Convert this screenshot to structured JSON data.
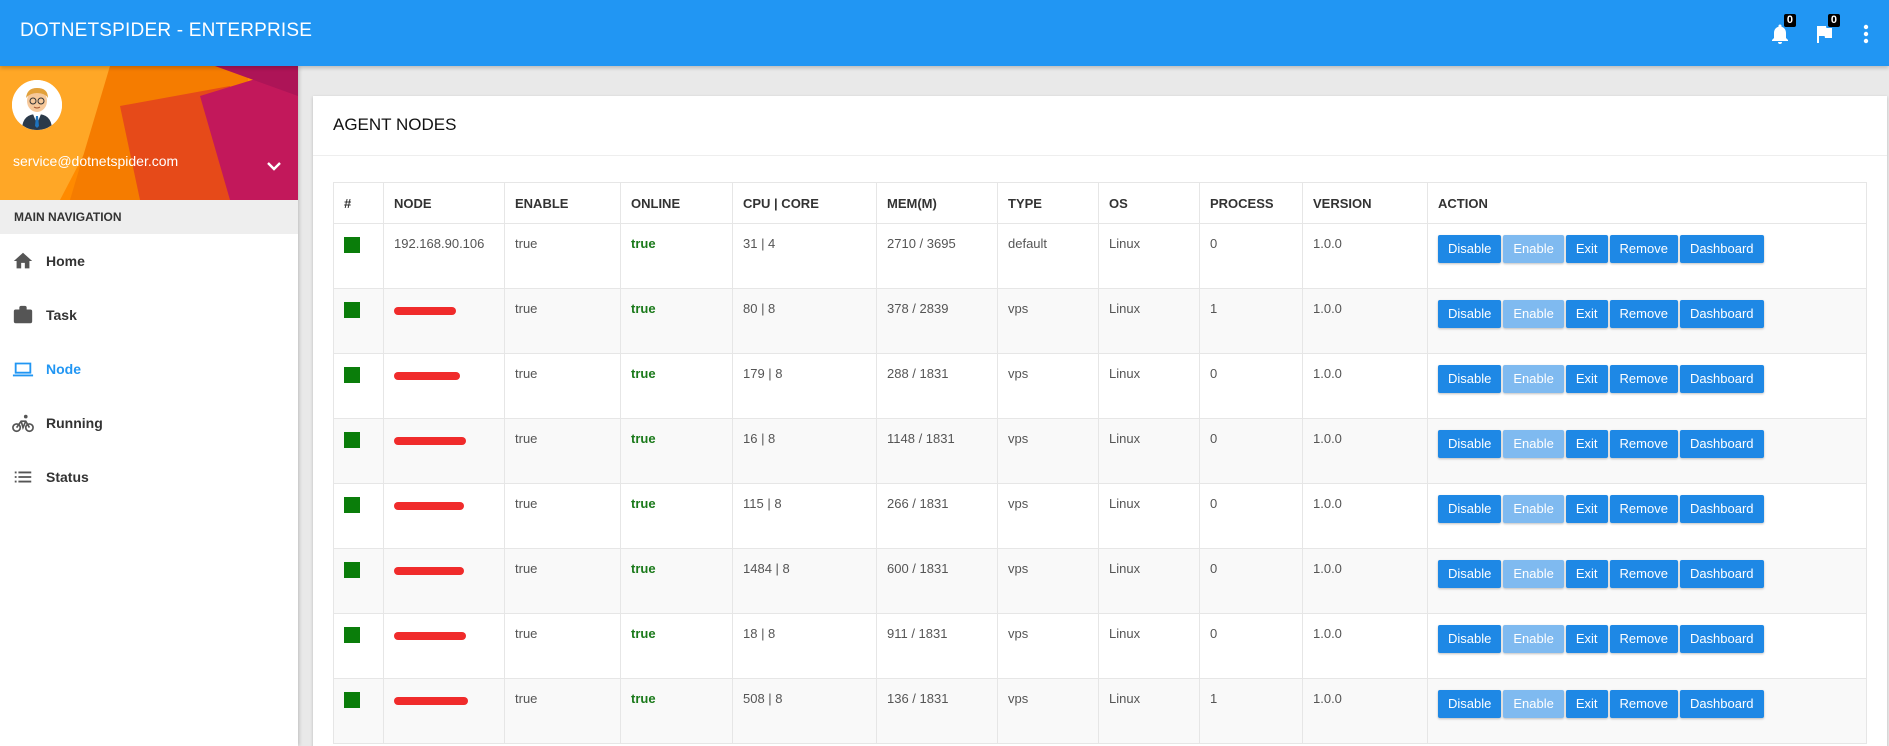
{
  "app": {
    "title": "DOTNETSPIDER - ENTERPRISE"
  },
  "header": {
    "notifications_count": "0",
    "flags_count": "0"
  },
  "user": {
    "email": "service@dotnetspider.com"
  },
  "nav": {
    "header": "MAIN NAVIGATION",
    "items": [
      {
        "label": "Home",
        "icon": "home-icon"
      },
      {
        "label": "Task",
        "icon": "briefcase-icon"
      },
      {
        "label": "Node",
        "icon": "laptop-icon"
      },
      {
        "label": "Running",
        "icon": "bicycle-icon"
      },
      {
        "label": "Status",
        "icon": "list-icon"
      }
    ],
    "active": "Node"
  },
  "page": {
    "title": "AGENT NODES"
  },
  "table": {
    "columns": [
      "#",
      "NODE",
      "ENABLE",
      "ONLINE",
      "CPU | CORE",
      "MEM(M)",
      "TYPE",
      "OS",
      "PROCESS",
      "VERSION",
      "ACTION"
    ],
    "actions": [
      "Disable",
      "Enable",
      "Exit",
      "Remove",
      "Dashboard"
    ],
    "rows": [
      {
        "node": "192.168.90.106",
        "redacted": false,
        "enable": "true",
        "online": "true",
        "cpu": "31 | 4",
        "mem": "2710 / 3695",
        "type": "default",
        "os": "Linux",
        "process": "0",
        "version": "1.0.0"
      },
      {
        "node": "",
        "redacted": true,
        "enable": "true",
        "online": "true",
        "cpu": "80 | 8",
        "mem": "378 / 2839",
        "type": "vps",
        "os": "Linux",
        "process": "1",
        "version": "1.0.0"
      },
      {
        "node": "",
        "redacted": true,
        "enable": "true",
        "online": "true",
        "cpu": "179 | 8",
        "mem": "288 / 1831",
        "type": "vps",
        "os": "Linux",
        "process": "0",
        "version": "1.0.0"
      },
      {
        "node": "",
        "redacted": true,
        "enable": "true",
        "online": "true",
        "cpu": "16 | 8",
        "mem": "1148 / 1831",
        "type": "vps",
        "os": "Linux",
        "process": "0",
        "version": "1.0.0"
      },
      {
        "node": "",
        "redacted": true,
        "enable": "true",
        "online": "true",
        "cpu": "115 | 8",
        "mem": "266 / 1831",
        "type": "vps",
        "os": "Linux",
        "process": "0",
        "version": "1.0.0"
      },
      {
        "node": "",
        "redacted": true,
        "enable": "true",
        "online": "true",
        "cpu": "1484 | 8",
        "mem": "600 / 1831",
        "type": "vps",
        "os": "Linux",
        "process": "0",
        "version": "1.0.0"
      },
      {
        "node": "",
        "redacted": true,
        "enable": "true",
        "online": "true",
        "cpu": "18 | 8",
        "mem": "911 / 1831",
        "type": "vps",
        "os": "Linux",
        "process": "0",
        "version": "1.0.0"
      },
      {
        "node": "",
        "redacted": true,
        "enable": "true",
        "online": "true",
        "cpu": "508 | 8",
        "mem": "136 / 1831",
        "type": "vps",
        "os": "Linux",
        "process": "1",
        "version": "1.0.0"
      }
    ]
  },
  "colors": {
    "primary": "#2196f3",
    "button": "#1e88e5",
    "online": "#1b7a1b",
    "status": "#0a7d0a",
    "redaction": "#f02b2b"
  }
}
